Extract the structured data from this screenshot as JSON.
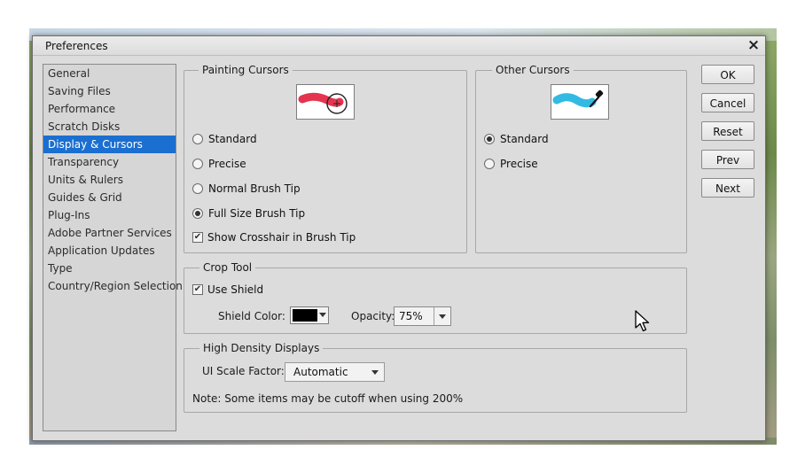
{
  "window": {
    "title": "Preferences",
    "close_glyph": "×"
  },
  "sidebar": {
    "items": [
      {
        "label": "General"
      },
      {
        "label": "Saving Files"
      },
      {
        "label": "Performance"
      },
      {
        "label": "Scratch Disks"
      },
      {
        "label": "Display & Cursors",
        "selected": true
      },
      {
        "label": "Transparency"
      },
      {
        "label": "Units & Rulers"
      },
      {
        "label": "Guides & Grid"
      },
      {
        "label": "Plug-Ins"
      },
      {
        "label": "Adobe Partner Services"
      },
      {
        "label": "Application Updates"
      },
      {
        "label": "Type"
      },
      {
        "label": "Country/Region Selection"
      }
    ]
  },
  "painting_cursors": {
    "title": "Painting Cursors",
    "options": [
      {
        "label": "Standard",
        "selected": false
      },
      {
        "label": "Precise",
        "selected": false
      },
      {
        "label": "Normal Brush Tip",
        "selected": false
      },
      {
        "label": "Full Size Brush Tip",
        "selected": true
      }
    ],
    "crosshair": {
      "label": "Show Crosshair in Brush Tip",
      "checked": true
    },
    "preview_icon": "brush-stroke-preview-icon"
  },
  "other_cursors": {
    "title": "Other Cursors",
    "options": [
      {
        "label": "Standard",
        "selected": true
      },
      {
        "label": "Precise",
        "selected": false
      }
    ],
    "preview_icon": "eyedropper-preview-icon"
  },
  "crop_tool": {
    "title": "Crop Tool",
    "use_shield": {
      "label": "Use Shield",
      "checked": true
    },
    "shield_color": {
      "label": "Shield Color:",
      "color": "#000000"
    },
    "opacity": {
      "label": "Opacity:",
      "value": "75%"
    }
  },
  "high_density": {
    "title": "High Density Displays",
    "scale_label": "UI Scale Factor:",
    "scale_value": "Automatic",
    "note": "Note: Some items may be cutoff when using 200%"
  },
  "buttons": {
    "ok": "OK",
    "cancel": "Cancel",
    "reset": "Reset",
    "prev": "Prev",
    "next": "Next"
  },
  "colors": {
    "selection": "#1b6fd0",
    "panel_bg": "#dcdcdc"
  }
}
